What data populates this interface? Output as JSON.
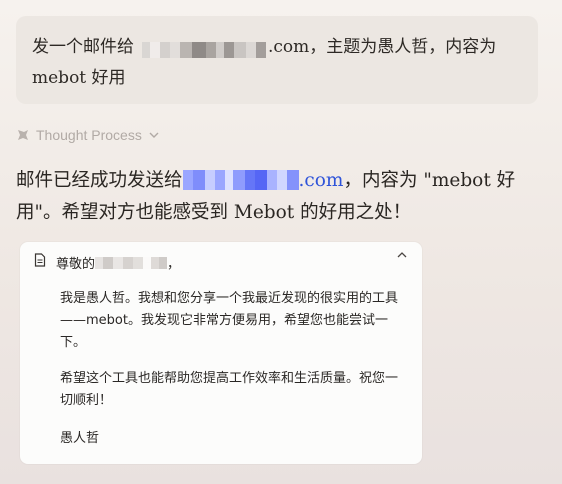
{
  "user_message": {
    "prefix": "发一个邮件给",
    "domain_suffix": ".com",
    "middle": "，主题为愚人哲，内容为",
    "line2": "mebot 好用"
  },
  "thought": {
    "label": "Thought Process",
    "icon": "sparkle-icon",
    "toggle_icon": "chevron-down-icon"
  },
  "reply": {
    "prefix": "邮件已经成功发送给",
    "domain_suffix": ".com",
    "middle": "，内容为 \"mebot 好",
    "line2": "用\"。希望对方也能感受到 Mebot 的好用之处！"
  },
  "email_card": {
    "greeting_prefix": "尊敬的",
    "greeting_suffix": "，",
    "paragraph1": "我是愚人哲。我想和您分享一个我最近发现的很实用的工具——mebot。我发现它非常方便易用，希望您也能尝试一下。",
    "paragraph2": "希望这个工具也能帮助您提高工作效率和生活质量。祝您一切顺利！",
    "signature": "愚人哲"
  },
  "colors": {
    "link": "#2f54d9",
    "bubble": "#ece7e2",
    "card": "#fcfcfb"
  }
}
